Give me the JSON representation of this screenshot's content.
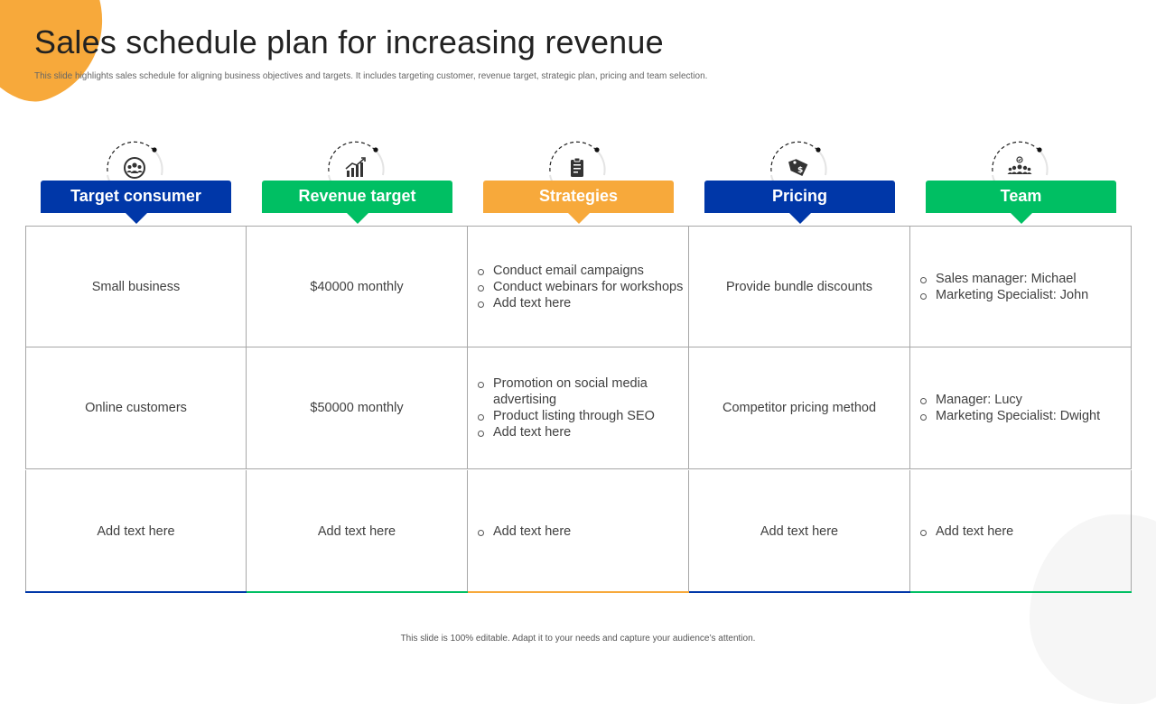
{
  "title": "Sales schedule plan for increasing revenue",
  "subtitle": "This slide highlights sales schedule for aligning business objectives and targets. It includes targeting customer, revenue target, strategic plan, pricing and team selection.",
  "footer": "This slide is 100% editable. Adapt it to your needs and capture your audience’s attention.",
  "colors": {
    "blue": "#0037a8",
    "green": "#00bf63",
    "orange": "#f7a93b",
    "accent_bg": "#f7a93b"
  },
  "columns": [
    {
      "header": "Target consumer",
      "icon": "target-audience-icon",
      "color": "#0037a8",
      "rows": [
        {
          "text": "Small business"
        },
        {
          "text": "Online customers"
        },
        {
          "text": "Add text here"
        }
      ]
    },
    {
      "header": "Revenue target",
      "icon": "growth-chart-icon",
      "color": "#00bf63",
      "rows": [
        {
          "text": "$40000 monthly"
        },
        {
          "text": "$50000 monthly"
        },
        {
          "text": "Add text here"
        }
      ]
    },
    {
      "header": "Strategies",
      "icon": "clipboard-icon",
      "color": "#f7a93b",
      "rows": [
        {
          "bullets": [
            "Conduct email campaigns",
            "Conduct webinars for workshops",
            "Add text here"
          ]
        },
        {
          "bullets": [
            "Promotion on social media advertising",
            "Product listing through SEO",
            "Add text here"
          ]
        },
        {
          "bullets": [
            "Add text here"
          ]
        }
      ]
    },
    {
      "header": "Pricing",
      "icon": "price-tag-icon",
      "color": "#0037a8",
      "rows": [
        {
          "text": "Provide bundle discounts"
        },
        {
          "text": "Competitor pricing method"
        },
        {
          "text": "Add text here"
        }
      ]
    },
    {
      "header": "Team",
      "icon": "team-icon",
      "color": "#00bf63",
      "rows": [
        {
          "bullets": [
            "Sales manager: Michael",
            "Marketing Specialist: John"
          ]
        },
        {
          "bullets": [
            "Manager: Lucy",
            "Marketing Specialist: Dwight"
          ]
        },
        {
          "bullets": [
            "Add text here"
          ]
        }
      ]
    }
  ]
}
